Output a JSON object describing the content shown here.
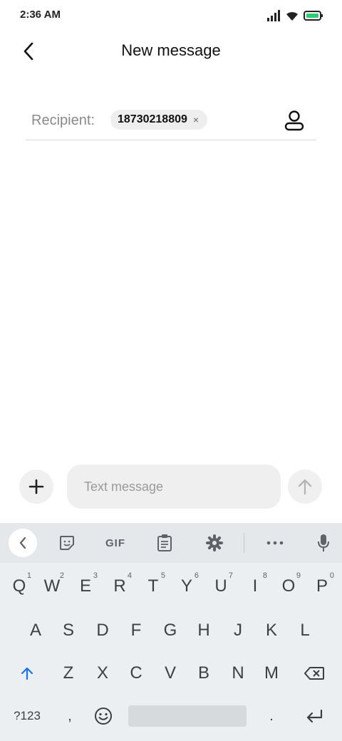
{
  "status_bar": {
    "time": "2:36 AM",
    "icons": [
      "signal-icon",
      "wifi-icon",
      "battery-icon"
    ],
    "battery_color": "#2ecc71"
  },
  "header": {
    "title": "New message",
    "back_icon": "chevron-left-icon"
  },
  "recipient": {
    "label": "Recipient:",
    "chip_value": "18730218809",
    "chip_close": "×",
    "contact_icon": "person-icon"
  },
  "compose": {
    "placeholder": "Text message",
    "add_icon": "plus-icon",
    "send_icon": "arrow-up-icon"
  },
  "keyboard": {
    "toolbar": {
      "gif_label": "GIF",
      "items": [
        "chevron-left-icon",
        "sticker-icon",
        "gif-icon",
        "clipboard-icon",
        "gear-icon",
        "more-icon",
        "mic-icon"
      ]
    },
    "row1": [
      {
        "key": "Q",
        "hint": "1"
      },
      {
        "key": "W",
        "hint": "2"
      },
      {
        "key": "E",
        "hint": "3"
      },
      {
        "key": "R",
        "hint": "4"
      },
      {
        "key": "T",
        "hint": "5"
      },
      {
        "key": "Y",
        "hint": "6"
      },
      {
        "key": "U",
        "hint": "7"
      },
      {
        "key": "I",
        "hint": "8"
      },
      {
        "key": "O",
        "hint": "9"
      },
      {
        "key": "P",
        "hint": "0"
      }
    ],
    "row2": [
      "A",
      "S",
      "D",
      "F",
      "G",
      "H",
      "J",
      "K",
      "L"
    ],
    "row3": [
      "Z",
      "X",
      "C",
      "V",
      "B",
      "N",
      "M"
    ],
    "row4": {
      "symbols": "?123",
      "comma": ",",
      "period": "."
    },
    "accent_color": "#1a73e8"
  }
}
